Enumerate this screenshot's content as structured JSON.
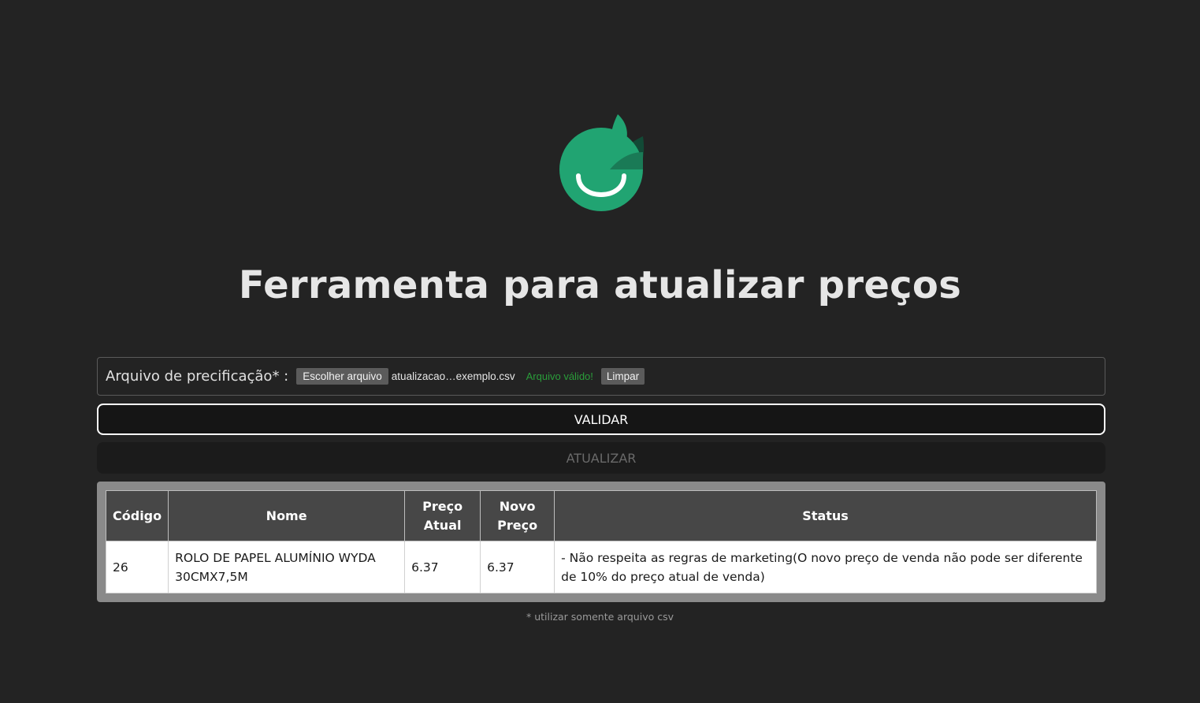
{
  "title": "Ferramenta para atualizar preços",
  "upload": {
    "label": "Arquivo de precificação* :",
    "choose_button": "Escolher arquivo",
    "file_name": "atualizacao…exemplo.csv",
    "status": "Arquivo válido!",
    "clear_button": "Limpar"
  },
  "actions": {
    "validate": "VALIDAR",
    "update": "ATUALIZAR"
  },
  "table": {
    "headers": [
      "Código",
      "Nome",
      "Preço Atual",
      "Novo Preço",
      "Status"
    ],
    "rows": [
      {
        "codigo": "26",
        "nome": "ROLO DE PAPEL ALUMÍNIO WYDA 30CMX7,5M",
        "preco_atual": "6.37",
        "novo_preco": "6.37",
        "status": "- Não respeita as regras de marketing(O novo preço de venda não pode ser diferente de 10% do preço atual de venda)"
      }
    ]
  },
  "footnote": "* utilizar somente arquivo csv",
  "colors": {
    "background": "#232323",
    "brand_green": "#21a472",
    "brand_dark_green": "#124a36",
    "valid_green": "#2a9d3a"
  }
}
